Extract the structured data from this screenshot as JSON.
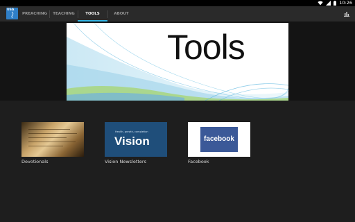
{
  "status_bar": {
    "time": "10:26"
  },
  "app": {
    "logo_text": "USA"
  },
  "tabs": [
    {
      "label": "PREACHING"
    },
    {
      "label": "TEACHING"
    },
    {
      "label": "TOOLS",
      "active": true
    },
    {
      "label": "ABOUT"
    }
  ],
  "banner": {
    "title": "Tools"
  },
  "tiles": [
    {
      "label": "Devotionals"
    },
    {
      "label": "Vision Newsletters",
      "small_text": "Health, growth, completion",
      "big_text": "Vision"
    },
    {
      "label": "Facebook",
      "logo_text": "facebook"
    }
  ],
  "colors": {
    "accent": "#33b5e5",
    "action_bar": "#2a2a2a",
    "background": "#1e1e1e",
    "facebook_blue": "#3b5998",
    "vision_blue": "#1f4e7a"
  },
  "icons": {
    "status": [
      "wifi-icon",
      "signal-icon",
      "battery-icon"
    ],
    "action": "chart-icon"
  }
}
